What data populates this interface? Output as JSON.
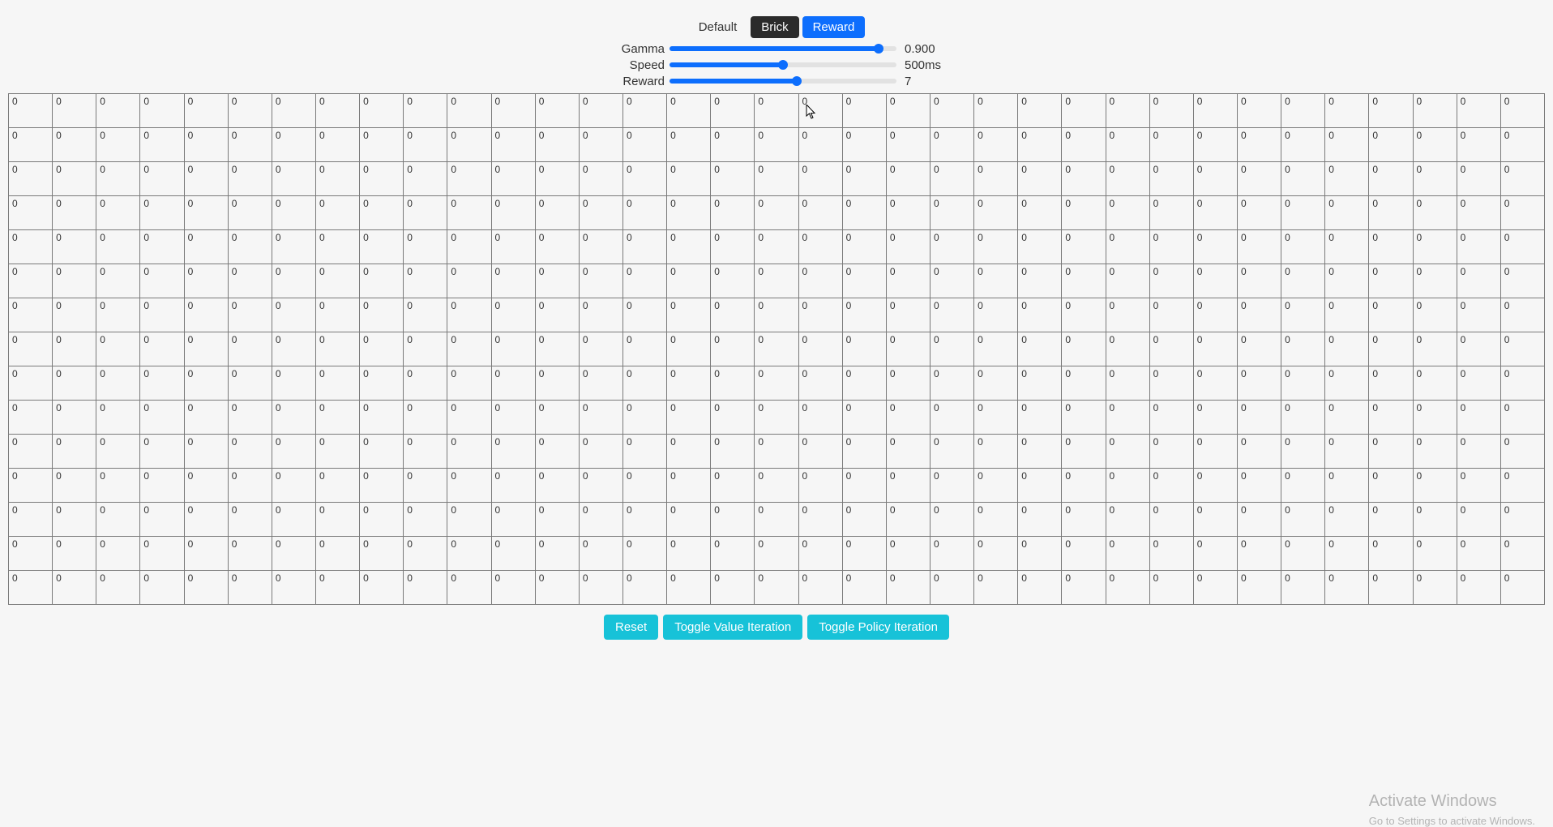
{
  "modes": {
    "default": "Default",
    "brick": "Brick",
    "reward": "Reward"
  },
  "sliders": {
    "gamma": {
      "label": "Gamma",
      "value": "0.900",
      "percent": 92
    },
    "speed": {
      "label": "Speed",
      "value": "500ms",
      "percent": 50
    },
    "reward": {
      "label": "Reward",
      "value": "7",
      "percent": 56
    }
  },
  "grid": {
    "rows": 15,
    "cols": 35,
    "cell_value": "0"
  },
  "actions": {
    "reset": "Reset",
    "toggle_value": "Toggle Value Iteration",
    "toggle_policy": "Toggle Policy Iteration"
  },
  "watermark": {
    "title": "Activate Windows",
    "sub": "Go to Settings to activate Windows."
  }
}
